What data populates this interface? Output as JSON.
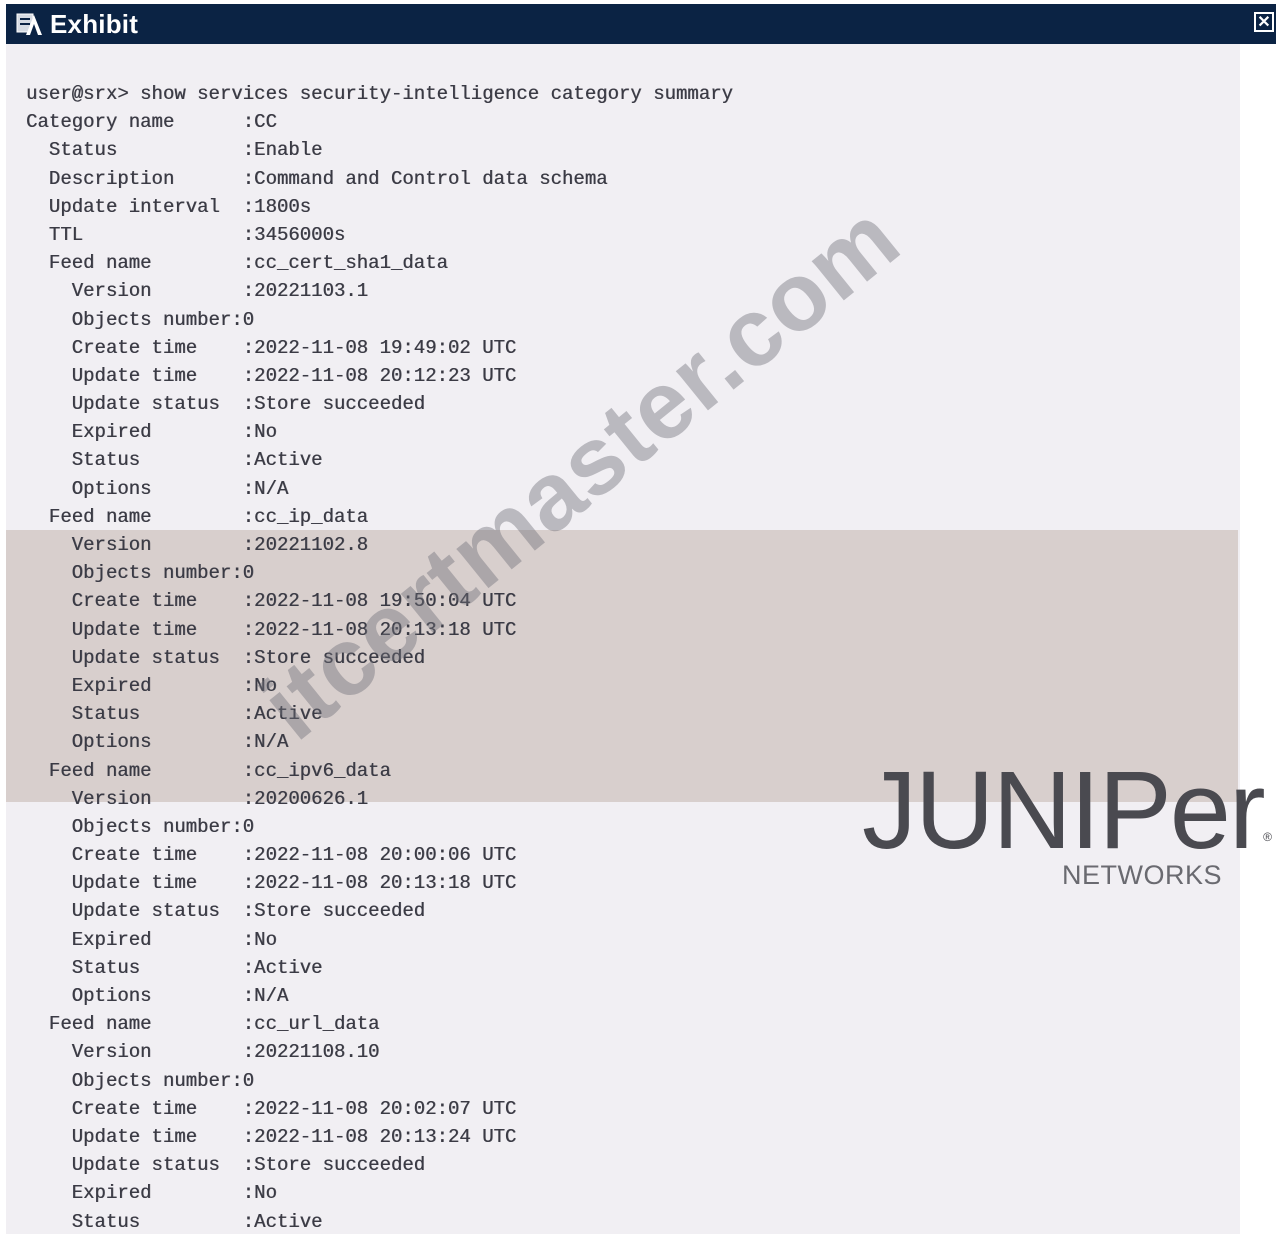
{
  "window": {
    "title": "Exhibit",
    "close_label": "✕"
  },
  "terminal": {
    "lines": [
      "user@srx> show services security-intelligence category summary",
      "Category name      :CC",
      "  Status           :Enable",
      "  Description      :Command and Control data schema",
      "  Update interval  :1800s",
      "  TTL              :3456000s",
      "  Feed name        :cc_cert_sha1_data",
      "    Version        :20221103.1",
      "    Objects number:0",
      "    Create time    :2022-11-08 19:49:02 UTC",
      "    Update time    :2022-11-08 20:12:23 UTC",
      "    Update status  :Store succeeded",
      "    Expired        :No",
      "    Status         :Active",
      "    Options        :N/A",
      "  Feed name        :cc_ip_data",
      "    Version        :20221102.8",
      "    Objects number:0",
      "    Create time    :2022-11-08 19:50:04 UTC",
      "    Update time    :2022-11-08 20:13:18 UTC",
      "    Update status  :Store succeeded",
      "    Expired        :No",
      "    Status         :Active",
      "    Options        :N/A",
      "  Feed name        :cc_ipv6_data",
      "    Version        :20200626.1",
      "    Objects number:0",
      "    Create time    :2022-11-08 20:00:06 UTC",
      "    Update time    :2022-11-08 20:13:18 UTC",
      "    Update status  :Store succeeded",
      "    Expired        :No",
      "    Status         :Active",
      "    Options        :N/A",
      "  Feed name        :cc_url_data",
      "    Version        :20221108.10",
      "    Objects number:0",
      "    Create time    :2022-11-08 20:02:07 UTC",
      "    Update time    :2022-11-08 20:13:24 UTC",
      "    Update status  :Store succeeded",
      "    Expired        :No",
      "    Status         :Active"
    ]
  },
  "watermark": "itcertmaster.com",
  "logo": {
    "word": "JUNIPer",
    "registered": "®",
    "sub": "NETWORKS"
  },
  "colors": {
    "titlebar": "#0b2344",
    "band": "#d8cfcd",
    "text": "#3a3a44"
  },
  "icons": {
    "title": "exhibit-icon",
    "close": "close-icon"
  }
}
